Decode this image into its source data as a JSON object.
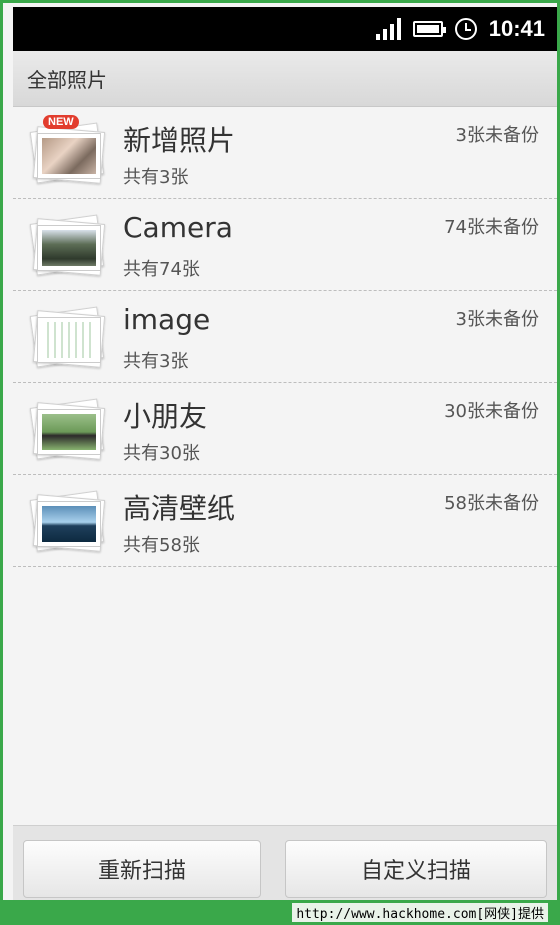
{
  "status_bar": {
    "time": "10:41",
    "icons": [
      "signal-icon",
      "battery-icon",
      "alarm-clock-icon"
    ]
  },
  "header": {
    "title": "全部照片"
  },
  "albums": [
    {
      "name": "新增照片",
      "count": "共有3张",
      "backup": "3张未备份",
      "badge": "NEW",
      "thumb": "img-new"
    },
    {
      "name": "Camera",
      "count": "共有74张",
      "backup": "74张未备份",
      "badge": "",
      "thumb": "img-camera"
    },
    {
      "name": "image",
      "count": "共有3张",
      "backup": "3张未备份",
      "badge": "",
      "thumb": "img-image"
    },
    {
      "name": "小朋友",
      "count": "共有30张",
      "backup": "30张未备份",
      "badge": "",
      "thumb": "img-kid"
    },
    {
      "name": "高清壁纸",
      "count": "共有58张",
      "backup": "58张未备份",
      "badge": "",
      "thumb": "img-sky"
    }
  ],
  "buttons": {
    "rescan": "重新扫描",
    "custom_scan": "自定义扫描"
  },
  "footer": {
    "watermark": "http://www.hackhome.com[网侠]提供"
  },
  "colors": {
    "accent_green": "#3aa84a",
    "badge_red": "#e23d2e"
  }
}
